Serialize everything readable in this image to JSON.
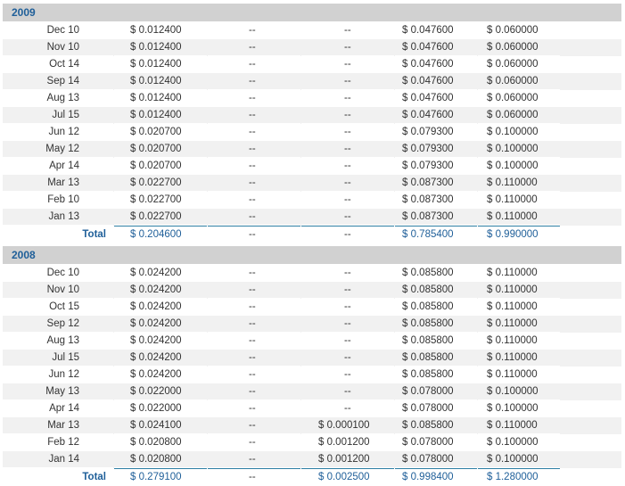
{
  "sections": [
    {
      "year": "2009",
      "rows": [
        [
          "Dec 10",
          "$ 0.012400",
          "--",
          "--",
          "$ 0.047600",
          "$ 0.060000"
        ],
        [
          "Nov 10",
          "$ 0.012400",
          "--",
          "--",
          "$ 0.047600",
          "$ 0.060000"
        ],
        [
          "Oct 14",
          "$ 0.012400",
          "--",
          "--",
          "$ 0.047600",
          "$ 0.060000"
        ],
        [
          "Sep 14",
          "$ 0.012400",
          "--",
          "--",
          "$ 0.047600",
          "$ 0.060000"
        ],
        [
          "Aug 13",
          "$ 0.012400",
          "--",
          "--",
          "$ 0.047600",
          "$ 0.060000"
        ],
        [
          "Jul 15",
          "$ 0.012400",
          "--",
          "--",
          "$ 0.047600",
          "$ 0.060000"
        ],
        [
          "Jun 12",
          "$ 0.020700",
          "--",
          "--",
          "$ 0.079300",
          "$ 0.100000"
        ],
        [
          "May 12",
          "$ 0.020700",
          "--",
          "--",
          "$ 0.079300",
          "$ 0.100000"
        ],
        [
          "Apr 14",
          "$ 0.020700",
          "--",
          "--",
          "$ 0.079300",
          "$ 0.100000"
        ],
        [
          "Mar 13",
          "$ 0.022700",
          "--",
          "--",
          "$ 0.087300",
          "$ 0.110000"
        ],
        [
          "Feb 10",
          "$ 0.022700",
          "--",
          "--",
          "$ 0.087300",
          "$ 0.110000"
        ],
        [
          "Jan 13",
          "$ 0.022700",
          "--",
          "--",
          "$ 0.087300",
          "$ 0.110000"
        ]
      ],
      "total": [
        "Total",
        "$ 0.204600",
        "--",
        "--",
        "$ 0.785400",
        "$ 0.990000"
      ]
    },
    {
      "year": "2008",
      "rows": [
        [
          "Dec 10",
          "$ 0.024200",
          "--",
          "--",
          "$ 0.085800",
          "$ 0.110000"
        ],
        [
          "Nov 10",
          "$ 0.024200",
          "--",
          "--",
          "$ 0.085800",
          "$ 0.110000"
        ],
        [
          "Oct 15",
          "$ 0.024200",
          "--",
          "--",
          "$ 0.085800",
          "$ 0.110000"
        ],
        [
          "Sep 12",
          "$ 0.024200",
          "--",
          "--",
          "$ 0.085800",
          "$ 0.110000"
        ],
        [
          "Aug 13",
          "$ 0.024200",
          "--",
          "--",
          "$ 0.085800",
          "$ 0.110000"
        ],
        [
          "Jul 15",
          "$ 0.024200",
          "--",
          "--",
          "$ 0.085800",
          "$ 0.110000"
        ],
        [
          "Jun 12",
          "$ 0.024200",
          "--",
          "--",
          "$ 0.085800",
          "$ 0.110000"
        ],
        [
          "May 13",
          "$ 0.022000",
          "--",
          "--",
          "$ 0.078000",
          "$ 0.100000"
        ],
        [
          "Apr 14",
          "$ 0.022000",
          "--",
          "--",
          "$ 0.078000",
          "$ 0.100000"
        ],
        [
          "Mar 13",
          "$ 0.024100",
          "--",
          "$ 0.000100",
          "$ 0.085800",
          "$ 0.110000"
        ],
        [
          "Feb 12",
          "$ 0.020800",
          "--",
          "$ 0.001200",
          "$ 0.078000",
          "$ 0.100000"
        ],
        [
          "Jan 14",
          "$ 0.020800",
          "--",
          "$ 0.001200",
          "$ 0.078000",
          "$ 0.100000"
        ]
      ],
      "total": [
        "Total",
        "$ 0.279100",
        "--",
        "$ 0.002500",
        "$ 0.998400",
        "$ 1.280000"
      ]
    }
  ],
  "colors": {
    "header_bg": "#d1d1d1",
    "year_text": "#1f5f99",
    "alt_row": "#f1f1f1",
    "total_line": "#2e7fa3"
  }
}
